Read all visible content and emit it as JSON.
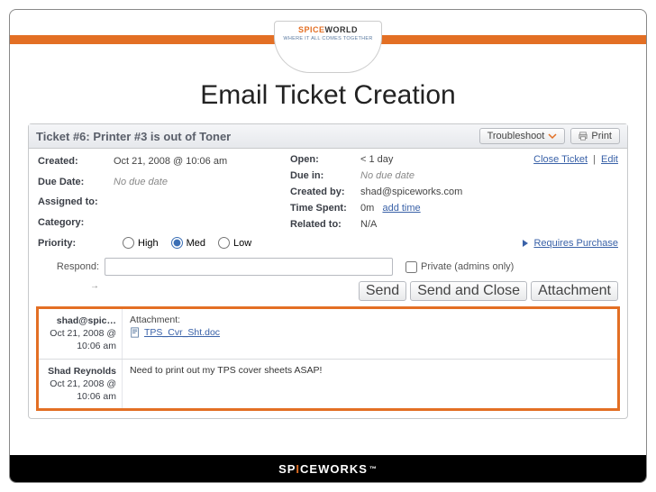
{
  "slide_title": "Email Ticket Creation",
  "badge": {
    "brand_pre": "SPICE",
    "brand_post": "WORLD",
    "tagline": "WHERE IT ALL COMES TOGETHER"
  },
  "footer": {
    "brand_pre": "SP",
    "brand_mid": "I",
    "brand_post": "CEWORKS",
    "tm": "™"
  },
  "header": {
    "title": "Ticket #6: Printer #3 is out of Toner",
    "troubleshoot": "Troubleshoot",
    "print": "Print"
  },
  "actions": {
    "close": "Close Ticket",
    "edit": "Edit"
  },
  "meta": {
    "created_label": "Created:",
    "created_value": "Oct 21, 2008 @ 10:06 am",
    "due_date_label": "Due Date:",
    "due_date_value": "No due date",
    "assigned_label": "Assigned to:",
    "assigned_value": "",
    "category_label": "Category:",
    "category_value": "",
    "open_label": "Open:",
    "open_value": "< 1 day",
    "due_in_label": "Due in:",
    "due_in_value": "No due date",
    "created_by_label": "Created by:",
    "created_by_value": "shad@spiceworks.com",
    "time_spent_label": "Time Spent:",
    "time_spent_value": "0m",
    "add_time": "add time",
    "related_label": "Related to:",
    "related_value": "N/A"
  },
  "priority": {
    "label": "Priority:",
    "high": "High",
    "med": "Med",
    "low": "Low",
    "requires": "Requires Purchase"
  },
  "respond": {
    "label": "Respond:",
    "arrow": "→",
    "private": "Private (admins only)",
    "send": "Send",
    "send_close": "Send and Close",
    "attach": "Attachment"
  },
  "messages": [
    {
      "from": "shad@spic…",
      "when_line1": "Oct 21, 2008 @",
      "when_line2": "10:06 am",
      "attach_label": "Attachment:",
      "attach_name": "TPS_Cvr_Sht.doc"
    },
    {
      "from": "Shad Reynolds",
      "when_line1": "Oct 21, 2008 @",
      "when_line2": "10:06 am",
      "body": "Need to print out my TPS cover sheets ASAP!"
    }
  ]
}
